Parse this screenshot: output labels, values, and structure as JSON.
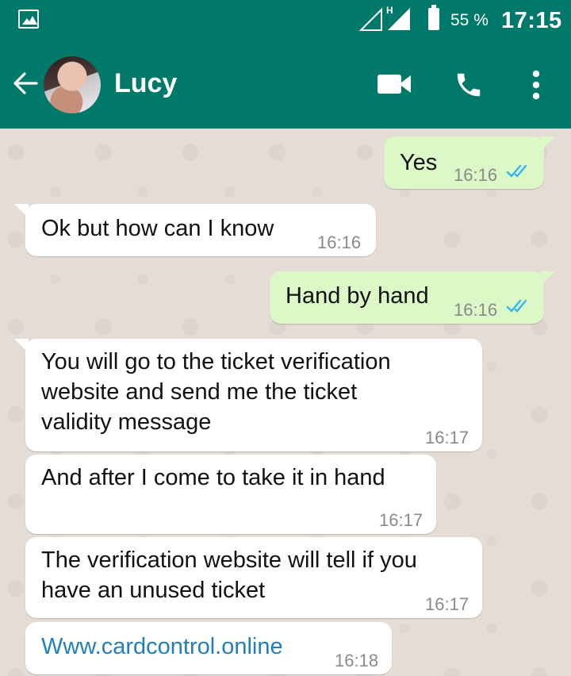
{
  "status_bar": {
    "network_type": "H",
    "battery_percent": "55 %",
    "battery_level": 0.55,
    "time": "17:15"
  },
  "header": {
    "contact_name": "Lucy",
    "icons": [
      "back-arrow-icon",
      "avatar",
      "video-call-icon",
      "phone-icon",
      "more-vertical-icon"
    ]
  },
  "colors": {
    "header": "#00796b",
    "outgoing_bubble": "#dcf8c6",
    "incoming_bubble": "#ffffff",
    "chat_background": "#e5ddd5",
    "read_ticks": "#34b7f1",
    "link": "#1f7fbf"
  },
  "messages": [
    {
      "direction": "outgoing",
      "text": "Yes",
      "time": "16:16",
      "status": "read"
    },
    {
      "direction": "incoming",
      "text": "Ok but how can I know",
      "time": "16:16"
    },
    {
      "direction": "outgoing",
      "text": "Hand by hand",
      "time": "16:16",
      "status": "read"
    },
    {
      "direction": "incoming",
      "lines": [
        "You will go to the ticket verification",
        "website and send me the ticket",
        "validity message"
      ],
      "time": "16:17"
    },
    {
      "direction": "incoming",
      "text": "And after I come to take it in hand",
      "time": "16:17"
    },
    {
      "direction": "incoming",
      "lines": [
        "The verification website will tell if you",
        "have an unused ticket"
      ],
      "time": "16:17"
    },
    {
      "direction": "incoming",
      "text": "Www.cardcontrol.online",
      "time": "16:18",
      "is_link": true
    }
  ]
}
